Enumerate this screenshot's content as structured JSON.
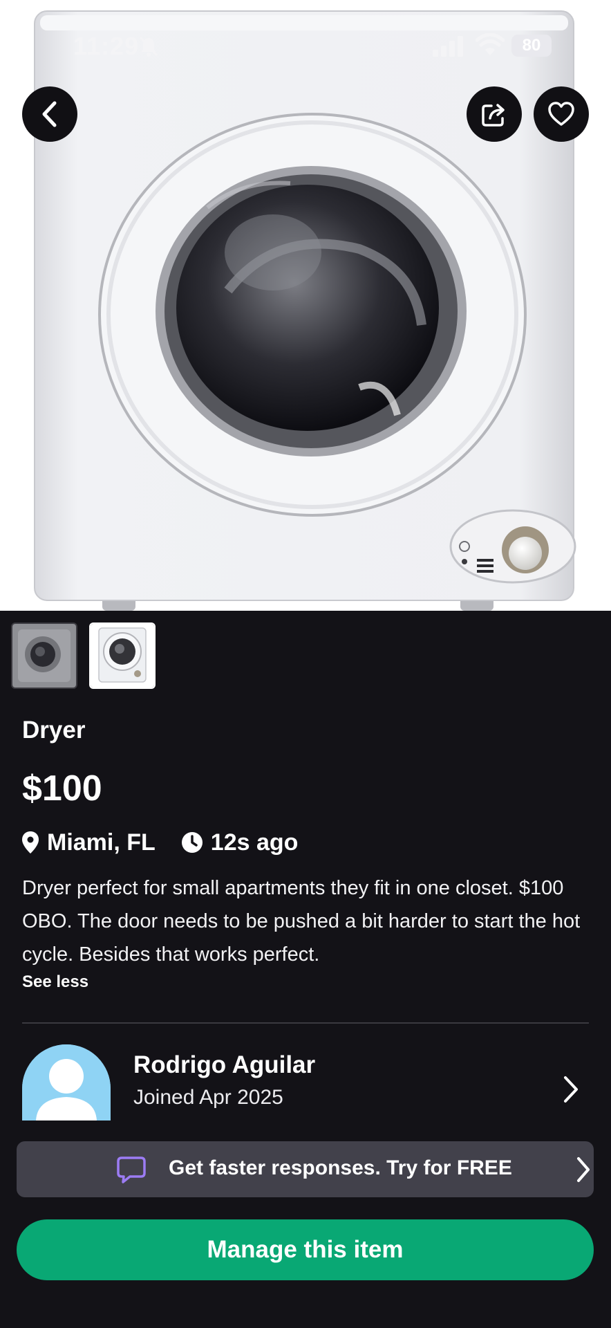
{
  "status_bar": {
    "time": "11:29",
    "battery": "80"
  },
  "listing": {
    "title": "Dryer",
    "price": "$100",
    "location": "Miami, FL",
    "posted": "12s ago",
    "description": "Dryer perfect for small apartments they fit in one closet. $100 OBO. The door needs to be pushed a bit harder to start the hot cycle. Besides that works perfect.",
    "see_less_label": "See less"
  },
  "seller": {
    "name": "Rodrigo Aguilar",
    "joined": "Joined Apr 2025"
  },
  "promo": {
    "label": "Get faster responses.  Try for FREE"
  },
  "manage_button": {
    "label": "Manage this item"
  },
  "icons": {
    "back": "back-arrow-icon",
    "share": "share-icon",
    "favorite": "heart-icon",
    "location": "location-pin-icon",
    "time": "clock-icon",
    "chat": "chat-bubble-icon"
  },
  "colors": {
    "background": "#131217",
    "accent_green": "#09a874",
    "promo_bg": "#42414b",
    "chat_icon": "#9c7cf4",
    "avatar_bg": "#8fd3f4"
  }
}
